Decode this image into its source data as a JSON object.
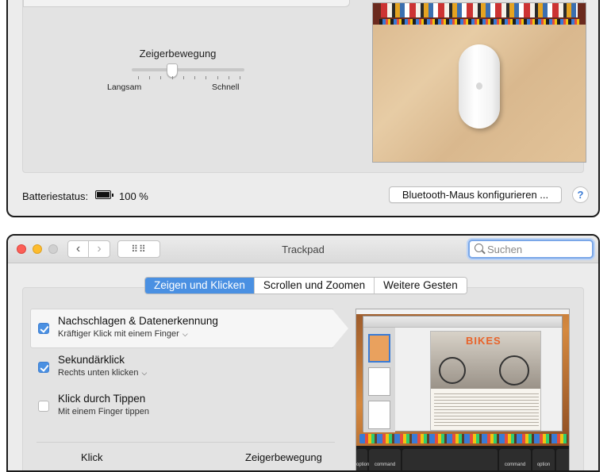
{
  "mouse_window": {
    "slider": {
      "title": "Zeigerbewegung",
      "min_label": "Langsam",
      "max_label": "Schnell",
      "value_fraction": 0.36,
      "tick_count": 10
    },
    "battery": {
      "label": "Batteriestatus:",
      "value": "100 %"
    },
    "bluetooth_button": "Bluetooth-Maus konfigurieren ...",
    "help_button": "?"
  },
  "trackpad_window": {
    "title": "Trackpad",
    "search": {
      "placeholder": "Suchen"
    },
    "nav": {
      "back": "‹",
      "forward": "›",
      "grid": "⠿⠿"
    },
    "tabs": [
      {
        "label": "Zeigen und Klicken",
        "active": true
      },
      {
        "label": "Scrollen und Zoomen",
        "active": false
      },
      {
        "label": "Weitere Gesten",
        "active": false
      }
    ],
    "options": [
      {
        "title": "Nachschlagen & Datenerkennung",
        "subtitle": "Kräftiger Klick mit einem Finger",
        "checked": true,
        "has_menu": true
      },
      {
        "title": "Sekundärklick",
        "subtitle": "Rechts unten klicken",
        "checked": true,
        "has_menu": true
      },
      {
        "title": "Klick durch Tippen",
        "subtitle": "Mit einem Finger tippen",
        "checked": false,
        "has_menu": false
      }
    ],
    "bottom_labels": {
      "click": "Klick",
      "pointer": "Zeigerbewegung"
    },
    "preview": {
      "doc_title": "BIKES",
      "keys": {
        "left_option": "option",
        "left_command": "command",
        "right_command": "command",
        "right_option": "option"
      }
    }
  },
  "colors": {
    "accent": "#4a90e2",
    "traffic_red": "#fc5f57",
    "traffic_yellow": "#fdbc2e",
    "window_bg": "#ececec"
  }
}
